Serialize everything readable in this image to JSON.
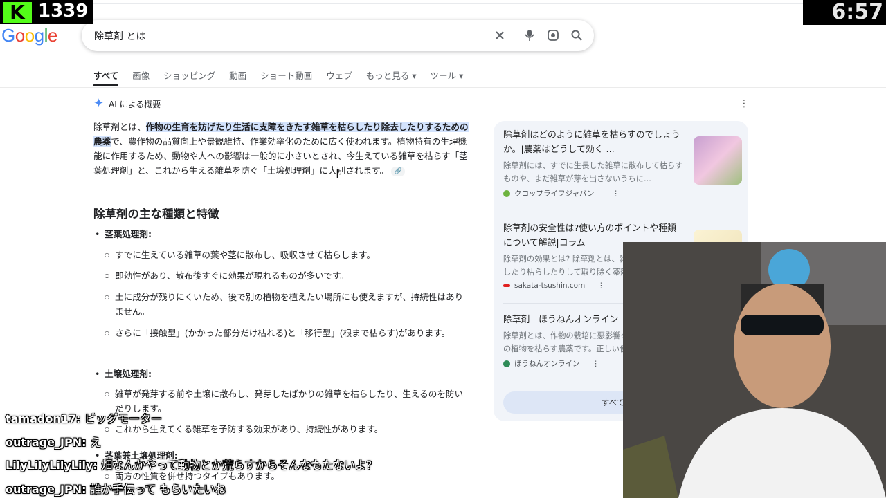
{
  "header": {
    "logo_letters": [
      {
        "ch": "G",
        "c": "b"
      },
      {
        "ch": "o",
        "c": "r"
      },
      {
        "ch": "o",
        "c": "y"
      },
      {
        "ch": "g",
        "c": "b"
      },
      {
        "ch": "l",
        "c": "g"
      },
      {
        "ch": "e",
        "c": "r"
      }
    ],
    "search_query": "除草剤 とは",
    "icons": [
      "clear-icon",
      "mic-icon",
      "lens-icon",
      "search-icon"
    ]
  },
  "tabs": [
    "すべて",
    "画像",
    "ショッピング",
    "動画",
    "ショート動画",
    "ウェブ",
    "もっと見る ▾",
    "ツール ▾"
  ],
  "ai_overview": {
    "label": "AI による概要",
    "intro_plain": "除草剤とは、",
    "intro_highlight": "作物の生育を妨げたり生活に支障をきたす雑草を枯らしたり除去したりするための農薬",
    "intro_rest": "で、農作物の品質向上や景観維持、作業効率化のために広く使われます。植物特有の生理機能に作用するため、動物や人への影響は一般的に小さいとされ、今生えている雑草を枯らす「茎葉処理剤」と、これから生える雑草を防ぐ「土壌処理剤」に大別されます。",
    "heading": "除草剤の主な種類と特徴",
    "types": [
      {
        "name": "茎葉処理剤:",
        "points": [
          "すでに生えている雑草の葉や茎に散布し、吸収させて枯らします。",
          "即効性があり、散布後すぐに効果が現れるものが多いです。",
          "土に成分が残りにくいため、後で別の植物を植えたい場所にも使えますが、持続性はありません。",
          "さらに「接触型」(かかった部分だけ枯れる)と「移行型」(根まで枯らす)があります。"
        ]
      },
      {
        "name": "土壌処理剤:",
        "points": [
          "雑草が発芽する前や土壌に散布し、発芽したばかりの雑草を枯らしたり、生えるのを防いだりします。",
          "これから生えてくる雑草を予防する効果があり、持続性があります。"
        ]
      },
      {
        "name": "茎葉兼土壌処理剤:",
        "points": [
          "両方の性質を併せ持つタイプもあります。"
        ]
      }
    ]
  },
  "sources": [
    {
      "title": "除草剤はどのように雑草を枯らすのでしょうか。|農薬はどうして効く ...",
      "snippet": "除草剤には、すでに生長した雑草に散布して枯らすものや、まだ雑草が芽を出さないうちに...",
      "site": "クロップライフジャパン",
      "color": "#6db33f"
    },
    {
      "title": "除草剤の安全性は?使い方のポイントや種類について解説|コラム",
      "snippet": "除草剤の効果とは? 除草剤とは、雑草の生育を抑制したり枯らしたりして取り除く薬剤のこ...",
      "site": "sakata-tsushin.com",
      "color": "#e02020"
    },
    {
      "title": "除草剤 - ほうねんオンライン",
      "snippet": "除草剤とは、作物の栽培に悪影響を及ぼす雑草などの植物を枯らす農薬です。正しい使い方...",
      "site": "ほうねんオンライン",
      "color": "#2e8b57"
    }
  ],
  "show_all": "すべて表示",
  "overlays": {
    "kick_logo": "K",
    "viewer_count": "1339",
    "clock": "6:57"
  },
  "chat": [
    {
      "user": "tamadon17:",
      "msg": "ビッグモーター"
    },
    {
      "user": "outrage_JPN:",
      "msg": "え"
    },
    {
      "user": "LilyLilyLilyLily:",
      "msg": "畑なんかやって動物とか荒らすからそんなもたないよ?"
    },
    {
      "user": "outrage_JPN:",
      "msg": "誰か手伝って もらいたいね"
    }
  ]
}
